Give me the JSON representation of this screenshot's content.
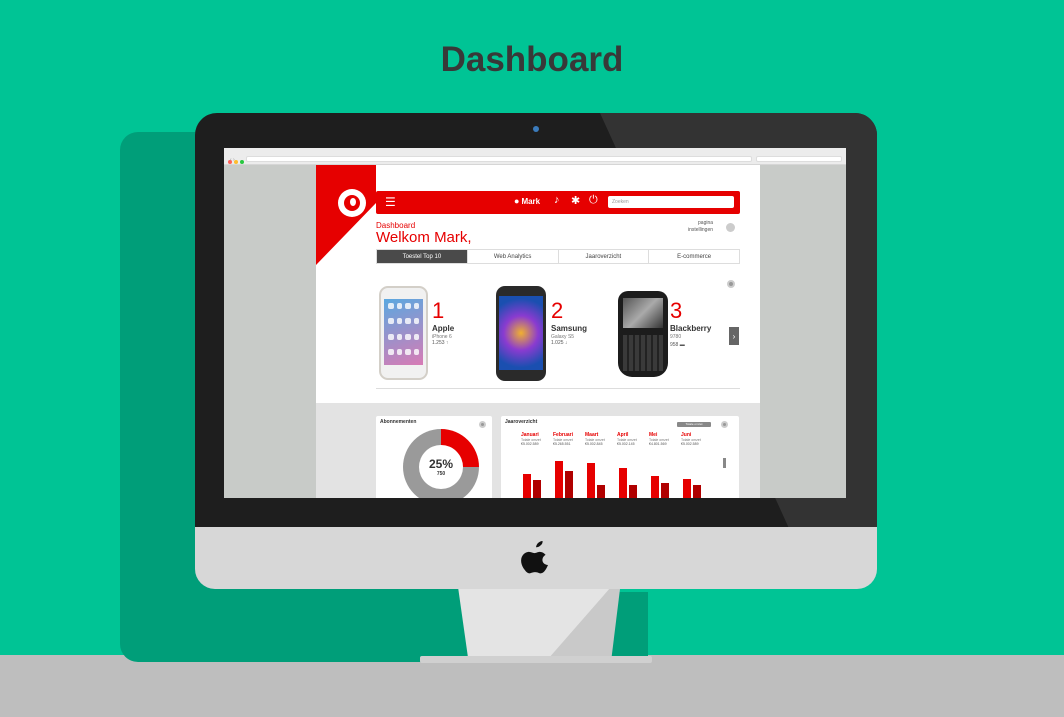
{
  "heading": "Dashboard",
  "browser": {
    "dot_colors": [
      "#ff5f57",
      "#febc2e",
      "#28c840"
    ],
    "nav_glyphs": "‹ ›"
  },
  "app": {
    "brand_color": "#E60000",
    "user_name": "Mark",
    "search_placeholder": "Zoeken",
    "breadcrumb": "Dashboard",
    "greeting": "Welkom Mark,",
    "settings_link": [
      "pagina",
      "instellingen"
    ],
    "tabs": [
      {
        "label": "Toestel Top 10",
        "active": true
      },
      {
        "label": "Web Analytics",
        "active": false
      },
      {
        "label": "Jaaroverzicht",
        "active": false
      },
      {
        "label": "E-commerce",
        "active": false
      }
    ],
    "top_devices": [
      {
        "rank": "1",
        "brand": "Apple",
        "model": "iPhone 6",
        "count": "1.253",
        "trend": "up"
      },
      {
        "rank": "2",
        "brand": "Samsung",
        "model": "Galaxy S5",
        "count": "1.025",
        "trend": "down"
      },
      {
        "rank": "3",
        "brand": "Blackberry",
        "model": "9780",
        "count": "958",
        "trend": "flat"
      }
    ],
    "next_glyph": "›"
  },
  "abonnementen": {
    "title": "Abonnementen",
    "percent": "25%",
    "value": "750",
    "fraction": 0.25
  },
  "jaaroverzicht": {
    "title": "Jaaroverzicht",
    "badge": "Totale omzet",
    "row_label": "Totale omzet",
    "months": [
      {
        "name": "Januari",
        "value": "€5.002.589"
      },
      {
        "name": "Februari",
        "value": "€5.265.551"
      },
      {
        "name": "Maart",
        "value": "€5.002.845"
      },
      {
        "name": "April",
        "value": "€5.002.145"
      },
      {
        "name": "Mei",
        "value": "€4.801.569"
      },
      {
        "name": "Juni",
        "value": "€5.002.589"
      }
    ],
    "chart_data": {
      "type": "bar",
      "categories": [
        "Januari",
        "Februari",
        "Maart",
        "April",
        "Mei",
        "Juni"
      ],
      "series": [
        {
          "values": [
            0.62,
            0.95,
            0.9,
            0.78,
            0.58,
            0.5
          ]
        },
        {
          "values": [
            0.48,
            0.7,
            0.35,
            0.36,
            0.4,
            0.35
          ]
        }
      ],
      "colors": [
        "#E60000",
        "#B00000"
      ]
    }
  }
}
